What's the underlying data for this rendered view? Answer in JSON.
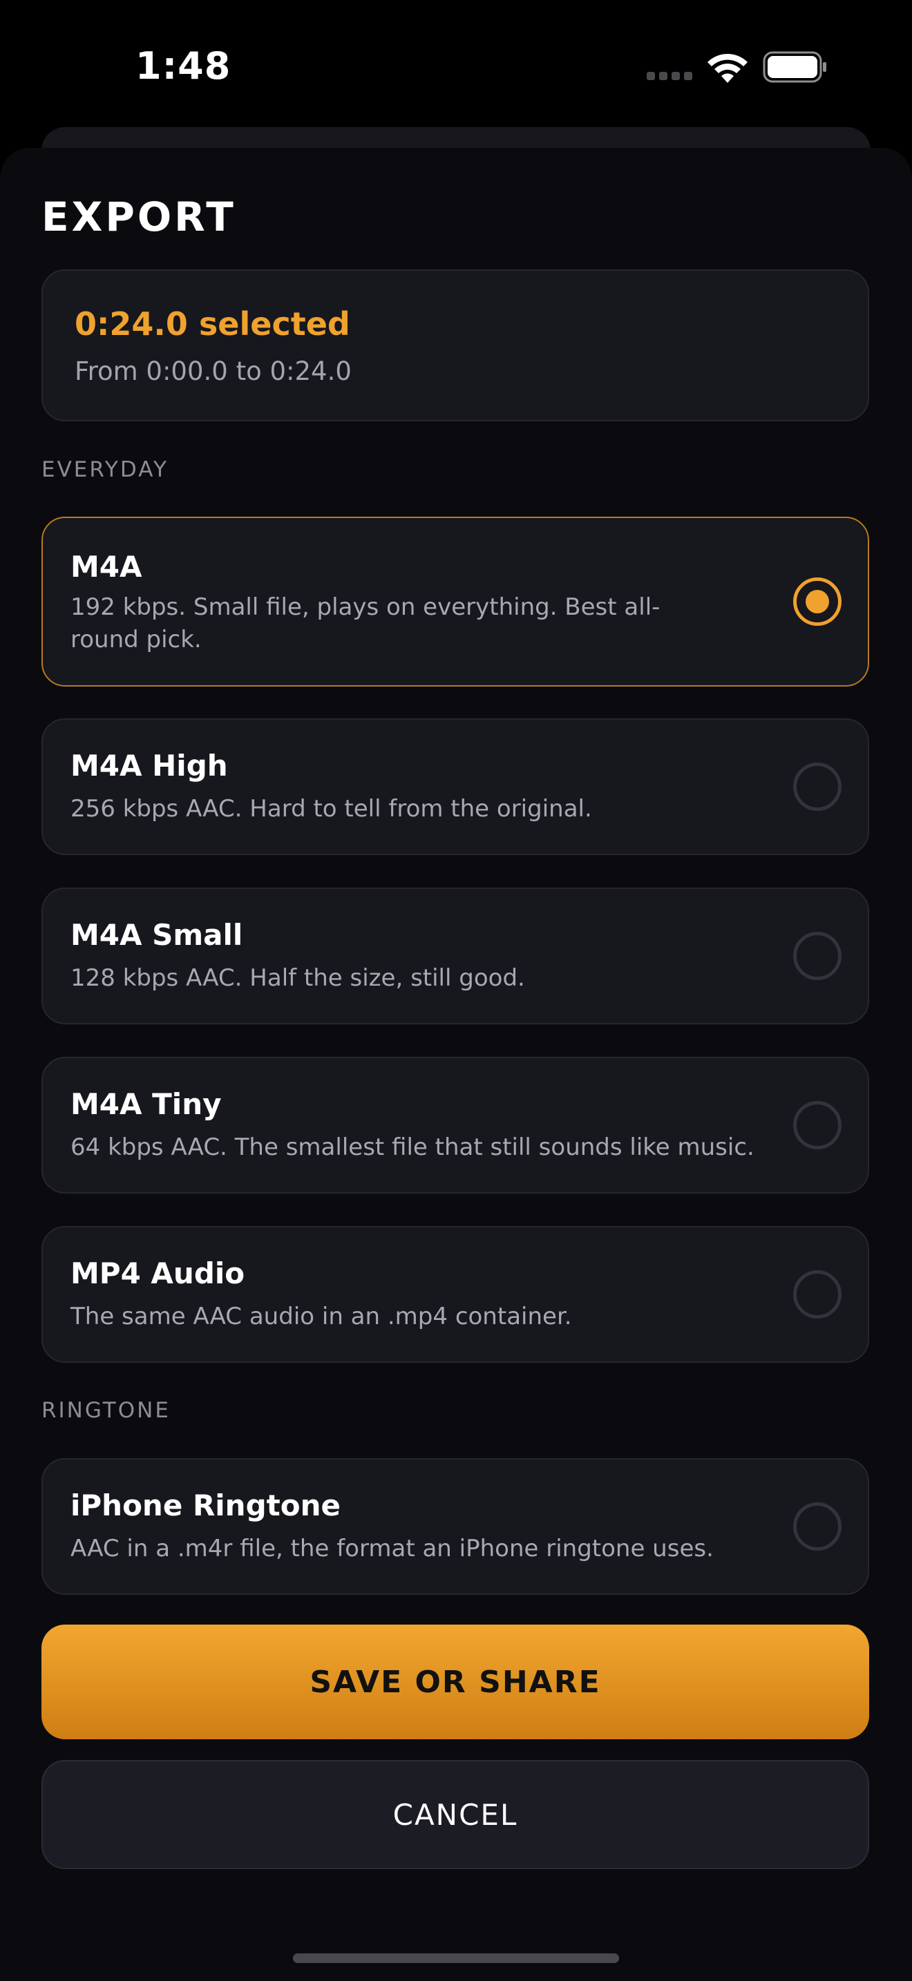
{
  "status_bar": {
    "time": "1:48",
    "icons": [
      "cellular-signal-icon",
      "wifi-icon",
      "battery-icon"
    ]
  },
  "sheet": {
    "title": "EXPORT",
    "selection": {
      "title": "0:24.0 selected",
      "range": "From 0:00.0 to 0:24.0"
    },
    "sections": [
      {
        "label": "EVERYDAY",
        "options": [
          {
            "title": "M4A",
            "description": "192 kbps. Small file, plays on everything. Best all-round pick.",
            "selected": true
          },
          {
            "title": "M4A High",
            "description": "256 kbps AAC. Hard to tell from the original.",
            "selected": false
          },
          {
            "title": "M4A Small",
            "description": "128 kbps AAC. Half the size, still good.",
            "selected": false
          },
          {
            "title": "M4A Tiny",
            "description": "64 kbps AAC. The smallest file that still sounds like music.",
            "selected": false
          },
          {
            "title": "MP4 Audio",
            "description": "The same AAC audio in an .mp4 container.",
            "selected": false
          }
        ]
      },
      {
        "label": "RINGTONE",
        "options": [
          {
            "title": "iPhone Ringtone",
            "description": "AAC in a .m4r file, the format an iPhone ringtone uses.",
            "selected": false
          }
        ]
      }
    ],
    "primary_button": "SAVE OR SHARE",
    "cancel_button": "CANCEL"
  },
  "colors": {
    "accent": "#f0a22e",
    "background": "#0b0b0f",
    "card": "#17171e"
  }
}
